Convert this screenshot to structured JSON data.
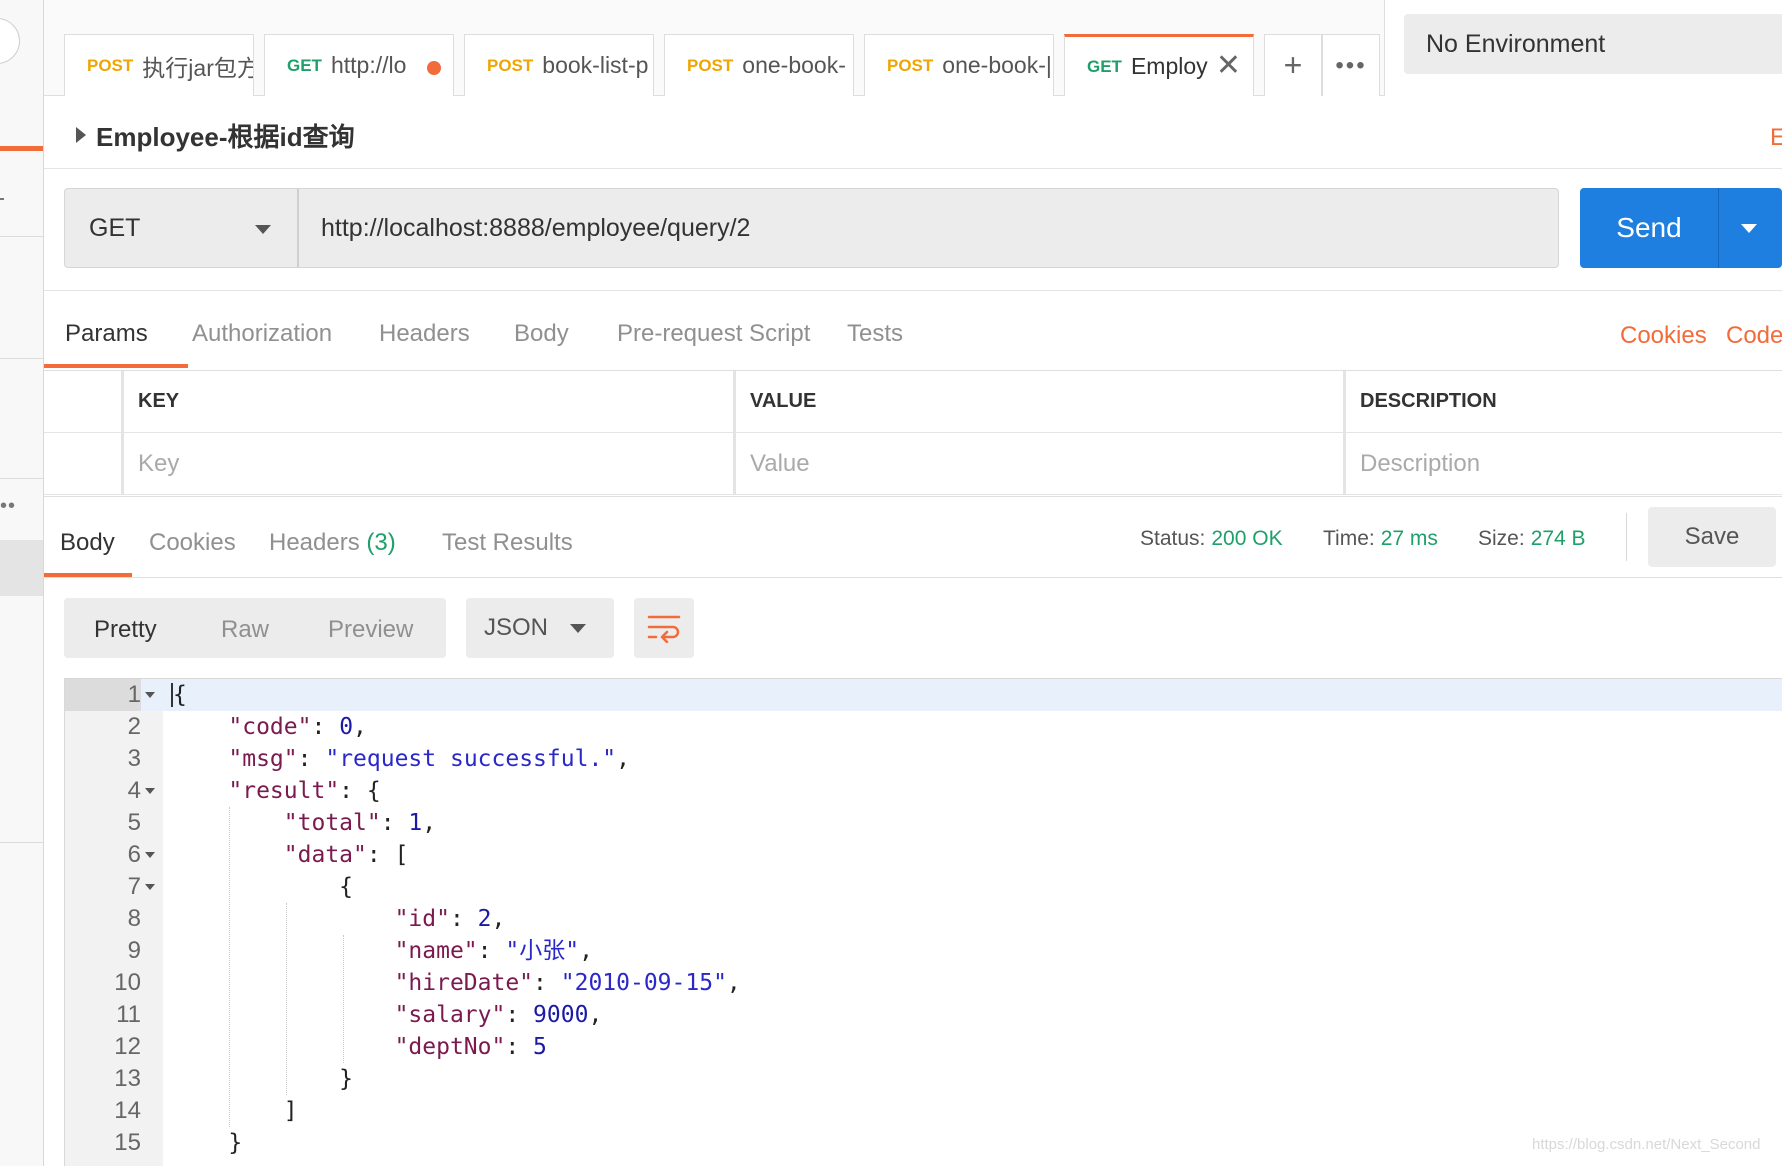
{
  "tabs": [
    {
      "method": "POST",
      "name": "执行jar包方",
      "state": "normal"
    },
    {
      "method": "GET",
      "name": "http://lo",
      "state": "unsaved"
    },
    {
      "method": "POST",
      "name": "book-list-p",
      "state": "normal"
    },
    {
      "method": "POST",
      "name": "one-book-",
      "state": "normal"
    },
    {
      "method": "POST",
      "name": "one-book-|",
      "state": "normal"
    },
    {
      "method": "GET",
      "name": "Employ",
      "state": "active"
    }
  ],
  "tab_actions": {
    "new_tab_icon": "plus-icon",
    "more_icon": "more-icon"
  },
  "environment": {
    "selected": "No Environment"
  },
  "request": {
    "title": "Employee-根据id查询",
    "edge_letter": "E",
    "method": "GET",
    "url": "http://localhost:8888/employee/query/2",
    "send_label": "Send"
  },
  "request_tabs": {
    "items": [
      "Params",
      "Authorization",
      "Headers",
      "Body",
      "Pre-request Script",
      "Tests"
    ],
    "active": "Params",
    "cookies_link": "Cookies",
    "code_link": "Code"
  },
  "params": {
    "headers": [
      "KEY",
      "VALUE",
      "DESCRIPTION"
    ],
    "placeholders": [
      "Key",
      "Value",
      "Description"
    ]
  },
  "response": {
    "tabs": {
      "body": "Body",
      "cookies": "Cookies",
      "headers": "Headers",
      "headers_count": "(3)",
      "tests": "Test Results"
    },
    "status_label": "Status:",
    "status_value": "200 OK",
    "time_label": "Time:",
    "time_value": "27 ms",
    "size_label": "Size:",
    "size_value": "274 B",
    "save_label": "Save",
    "view_modes": [
      "Pretty",
      "Raw",
      "Preview"
    ],
    "active_view": "Pretty",
    "format": "JSON"
  },
  "code_lines": [
    {
      "n": "1",
      "text": "{"
    },
    {
      "n": "2",
      "text": "    \"code\": 0,"
    },
    {
      "n": "3",
      "text": "    \"msg\": \"request successful.\","
    },
    {
      "n": "4",
      "text": "    \"result\": {"
    },
    {
      "n": "5",
      "text": "        \"total\": 1,"
    },
    {
      "n": "6",
      "text": "        \"data\": ["
    },
    {
      "n": "7",
      "text": "            {"
    },
    {
      "n": "8",
      "text": "                \"id\": 2,"
    },
    {
      "n": "9",
      "text": "                \"name\": \"小张\","
    },
    {
      "n": "10",
      "text": "                \"hireDate\": \"2010-09-15\","
    },
    {
      "n": "11",
      "text": "                \"salary\": 9000,"
    },
    {
      "n": "12",
      "text": "                \"deptNo\": 5"
    },
    {
      "n": "13",
      "text": "            }"
    },
    {
      "n": "14",
      "text": "        ]"
    },
    {
      "n": "15",
      "text": "    }"
    }
  ],
  "watermark": "https://blog.csdn.net/Next_Second",
  "colors": {
    "accent": "#f26b3a",
    "send": "#1e7fe0",
    "get": "#1f9f6a",
    "post": "#f0a600",
    "status": "#1f9f6a"
  }
}
